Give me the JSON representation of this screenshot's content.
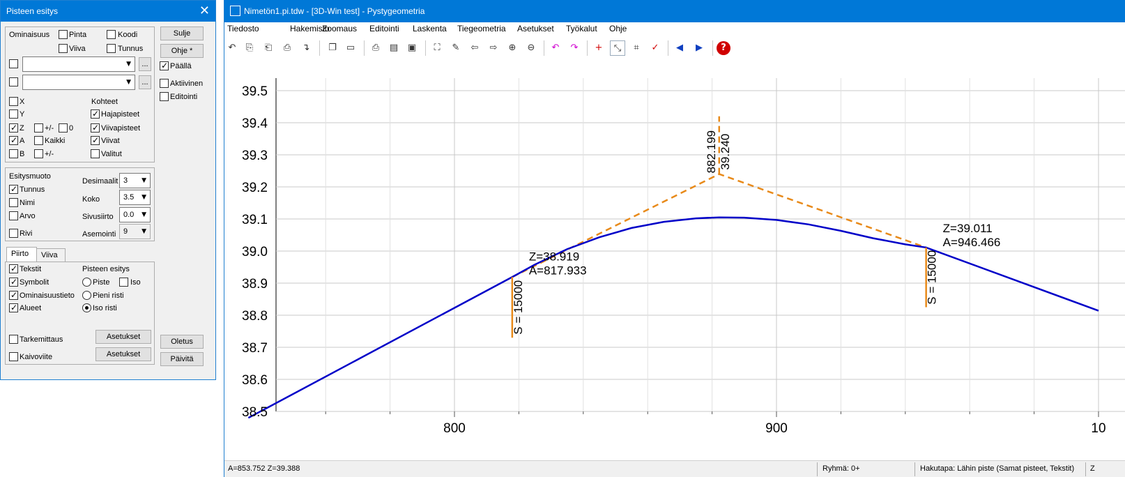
{
  "dialog": {
    "title": "Pisteen esitys",
    "close_icon": "close-icon",
    "buttons": {
      "close": "Sulje",
      "help": "Ohje *",
      "default": "Oletus",
      "refresh": "Päivitä",
      "settings1": "Asetukset",
      "settings2": "Asetukset"
    },
    "side_checks": {
      "on": "Päällä",
      "active": "Aktiivinen",
      "edit": "Editointi"
    },
    "attr": {
      "label": "Ominaisuus",
      "pinta": "Pinta",
      "koodi": "Koodi",
      "viiva": "Viiva",
      "tunnus": "Tunnus",
      "browse1": "...",
      "browse2": "...",
      "x": "X",
      "y": "Y",
      "z": "Z",
      "a": "A",
      "b": "B",
      "pm1": "+/-",
      "zero": "0",
      "kaikki": "Kaikki",
      "pm2": "+/-",
      "kohteet": "Kohteet",
      "hajapisteet": "Hajapisteet",
      "viivapisteet": "Viivapisteet",
      "viivat": "Viivat",
      "valitut": "Valitut"
    },
    "display": {
      "label": "Esitysmuoto",
      "tunnus": "Tunnus",
      "nimi": "Nimi",
      "arvo": "Arvo",
      "rivi": "Rivi",
      "desimaalit_label": "Desimaalit",
      "desimaalit": "3",
      "koko_label": "Koko",
      "koko": "3.5",
      "sivusiirto_label": "Sivusiirto",
      "sivusiirto": "0.0",
      "asemointi_label": "Asemointi",
      "asemointi": "9"
    },
    "tabs": {
      "piirto": "Piirto",
      "viiva": "Viiva"
    },
    "draw": {
      "tekstit": "Tekstit",
      "symbolit": "Symbolit",
      "ominaisuustieto": "Ominaisuustieto",
      "alueet": "Alueet",
      "pisteen_esitys": "Pisteen esitys",
      "piste": "Piste",
      "iso": "Iso",
      "pieni_risti": "Pieni risti",
      "iso_risti": "Iso risti",
      "tarkemittaus": "Tarkemittaus",
      "kaivoviite": "Kaivoviite"
    }
  },
  "window": {
    "title": "Nimetön1.pi.tdw - [3D-Win test] - Pystygeometria",
    "menu": [
      "Tiedosto",
      "Hakemisto",
      "Zoomaus",
      "Editointi",
      "Laskenta",
      "Tiegeometria",
      "Asetukset",
      "Työkalut",
      "Ohje"
    ],
    "toolbar_icons": [
      "undo-icon",
      "copy-icon",
      "paste-icon",
      "open-icon",
      "save-icon",
      "copy-page-icon",
      "new-page-icon",
      "print-icon",
      "scale-icon",
      "frame-icon",
      "zoom-extents-icon",
      "pen-icon",
      "pan-left-icon",
      "pan-right-icon",
      "zoom-in-icon",
      "zoom-out-icon",
      "undo-arrow-icon",
      "redo-arrow-icon",
      "add-point-icon",
      "measure-icon",
      "coords-icon",
      "check-icon",
      "prev-icon",
      "next-icon",
      "help-icon"
    ],
    "status": {
      "coords": "A=853.752  Z=39.388",
      "group": "Ryhmä: 0+",
      "snap": "Hakutapa: Lähin piste (Samat pisteet, Tekstit)",
      "extra": "Z"
    }
  },
  "chart_data": {
    "type": "line",
    "x_ticks": [
      800,
      900
    ],
    "x_tick_labels": [
      "800",
      "900",
      "10"
    ],
    "y_ticks": [
      38.5,
      38.6,
      38.7,
      38.8,
      38.9,
      39.0,
      39.1,
      39.2,
      39.3,
      39.4,
      39.5
    ],
    "y_tick_labels": [
      "38.5",
      "38.6",
      "38.7",
      "38.8",
      "38.9",
      "39.0",
      "39.1",
      "39.2",
      "39.3",
      "39.4",
      "39.5"
    ],
    "xlim": [
      744,
      1000
    ],
    "ylim": [
      38.48,
      39.54
    ],
    "grid": true,
    "colors": {
      "profile": "#0000c8",
      "tangent": "#e88a1a",
      "grid": "#c8c8c8"
    },
    "profile": [
      [
        736,
        38.48
      ],
      [
        817.933,
        38.919
      ],
      [
        825,
        38.958
      ],
      [
        835,
        39.006
      ],
      [
        845,
        39.043
      ],
      [
        855,
        39.072
      ],
      [
        865,
        39.091
      ],
      [
        875,
        39.102
      ],
      [
        882.199,
        39.105
      ],
      [
        890,
        39.104
      ],
      [
        900,
        39.097
      ],
      [
        910,
        39.083
      ],
      [
        920,
        39.063
      ],
      [
        930,
        39.04
      ],
      [
        940,
        39.021
      ],
      [
        946.466,
        39.011
      ],
      [
        1000,
        38.814
      ]
    ],
    "tangent_points": [
      [
        817.933,
        38.919
      ],
      [
        882.199,
        39.24
      ],
      [
        946.466,
        39.011
      ]
    ],
    "vertical_markers": [
      {
        "x": 817.933,
        "y_from": 38.73,
        "y_to": 38.919,
        "label": "S = 15000"
      },
      {
        "x": 946.466,
        "y_from": 38.825,
        "y_to": 39.011,
        "label": "S = 15000"
      },
      {
        "x": 882.199,
        "y_from": 39.24,
        "y_to": 39.42,
        "label": ""
      }
    ],
    "annotations": [
      {
        "x": 817.933,
        "y": 38.919,
        "lines": [
          "Z=38.919",
          "A=817.933"
        ]
      },
      {
        "x": 946.466,
        "y": 39.011,
        "lines": [
          "Z=39.011",
          "A=946.466"
        ]
      },
      {
        "x": 882.199,
        "y": 39.24,
        "lines": [
          "882.199",
          "39.240"
        ]
      }
    ]
  }
}
